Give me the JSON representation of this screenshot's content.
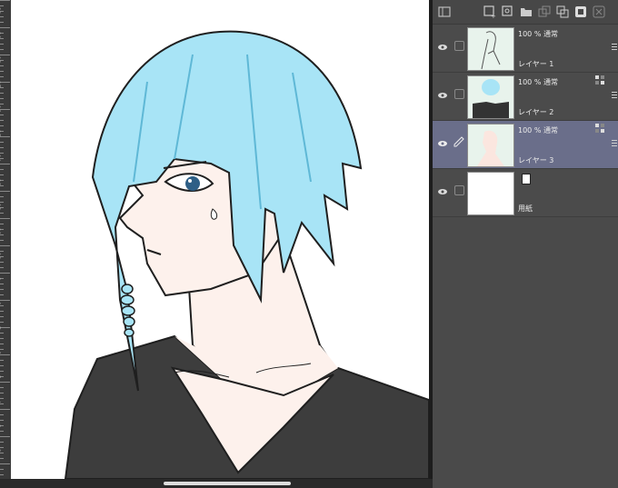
{
  "window": {
    "canvas_bg": "#ffffff",
    "panel_bg": "#4a4a4a",
    "selected_bg": "#6a6e8a"
  },
  "ruler": {
    "labels": [
      "20",
      "19",
      "18",
      "17",
      "16",
      "15",
      "14",
      "13",
      "12",
      "11",
      "10",
      "9",
      "8",
      "7",
      "6",
      "5",
      "4",
      "3",
      "2"
    ]
  },
  "toolbar": {
    "icons": [
      "layer-panel-icon",
      "new-raster-layer-icon",
      "new-vector-layer-icon",
      "new-folder-icon",
      "copy-layer-icon",
      "merge-layer-icon",
      "mask-icon",
      "delete-layer-icon"
    ]
  },
  "layers": [
    {
      "name": "レイヤー 1",
      "mode": "100 % 通常",
      "thumb": "line-sketch",
      "selected": false,
      "editing": false,
      "has_fx": false
    },
    {
      "name": "レイヤー 2",
      "mode": "100 % 通常",
      "thumb": "hair-shirt",
      "selected": false,
      "editing": false,
      "has_fx": true
    },
    {
      "name": "レイヤー 3",
      "mode": "100 % 通常",
      "thumb": "skin",
      "selected": true,
      "editing": true,
      "has_fx": true
    },
    {
      "name": "用紙",
      "mode": "",
      "thumb": "paper",
      "selected": false,
      "editing": false,
      "has_fx": false
    }
  ],
  "colors": {
    "hair": "#a8e4f6",
    "hair_dark": "#5fb8d6",
    "skin": "#fdf1ec",
    "shirt": "#3d3d3d",
    "line": "#1f1f1f",
    "eye": "#2e5f86"
  }
}
